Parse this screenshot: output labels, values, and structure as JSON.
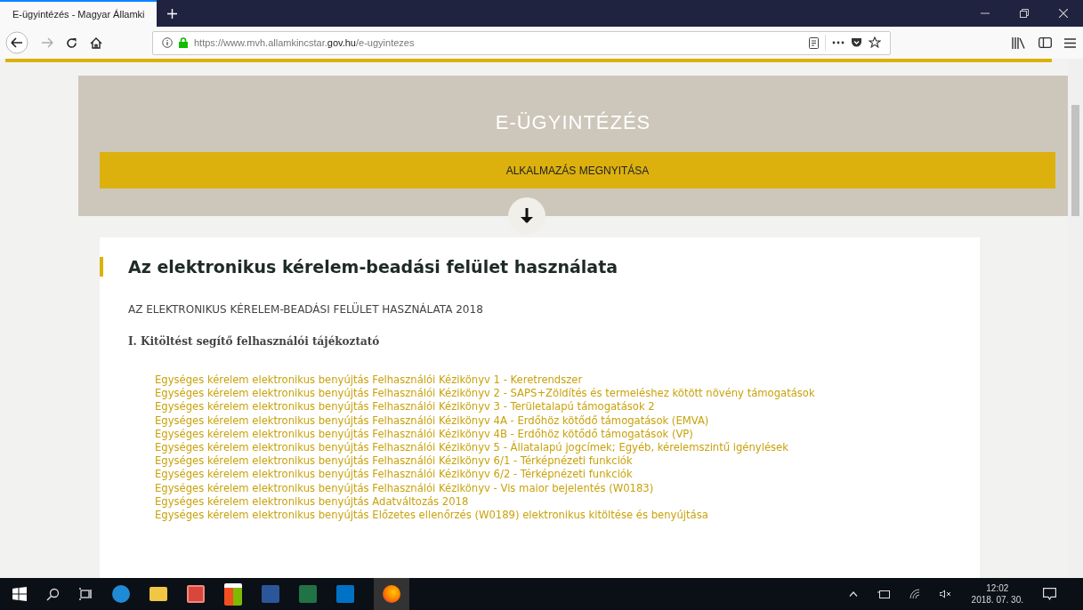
{
  "browser": {
    "tab_title": "E-ügyintézés - Magyar Államki",
    "url_prefix": "https://www.mvh.allamkincstar.",
    "url_domain": "gov.hu",
    "url_suffix": "/e-ugyintezes"
  },
  "hero": {
    "title": "E-ÜGYINTÉZÉS",
    "button": "ALKALMAZÁS MEGNYITÁSA"
  },
  "article": {
    "heading": "Az elektronikus kérelem-beadási felület használata",
    "subtitle": "AZ ELEKTRONIKUS KÉRELEM-BEADÁSI FELÜLET HASZNÁLATA 2018",
    "section": "I. Kitöltést segítő felhasználói tájékoztató",
    "links": [
      "Egységes kérelem elektronikus benyújtás Felhasználói Kézikönyv 1 - Keretrendszer",
      "Egységes kérelem elektronikus benyújtás Felhasználói Kézikönyv 2 - SAPS+Zöldítés és termeléshez kötött növény támogatások",
      "Egységes kérelem elektronikus benyújtás Felhasználói Kézikönyv 3 - Területalapú támogatások 2",
      "Egységes kérelem elektronikus benyújtás Felhasználói Kézikönyv 4A - Erdőhöz kötődő támogatások (EMVA)",
      "Egységes kérelem elektronikus benyújtás Felhasználói Kézikönyv 4B - Erdőhöz kötődő támogatások (VP)",
      "Egységes kérelem elektronikus benyújtás Felhasználói Kézikönyv 5 - Állatalapú jogcímek; Egyéb, kérelemszintű igénylések",
      "Egységes kérelem elektronikus benyújtás Felhasználói Kézikönyv 6/1 - Térképnézeti funkciók",
      "Egységes kérelem elektronikus benyújtás Felhasználói Kézikönyv 6/2 - Térképnézeti funkciók",
      "Egységes kérelem elektronikus benyújtás Felhasználói Kézikönyv - Vis maior bejelentés (W0183)",
      "Egységes kérelem elektronikus benyújtás Adatváltozás 2018",
      "Egységes kérelem elektronikus benyújtás Előzetes ellenőrzés (W0189) elektronikus kitöltése és benyújtása"
    ]
  },
  "taskbar": {
    "time": "12:02",
    "date": "2018. 07. 30."
  }
}
